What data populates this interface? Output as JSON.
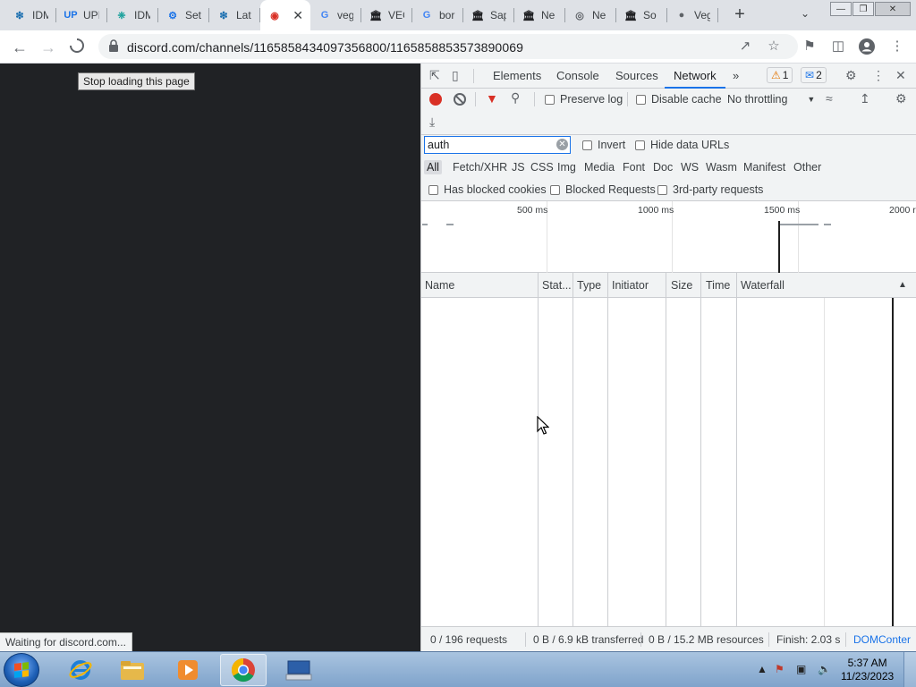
{
  "browser": {
    "tabs": [
      {
        "label": "IDM",
        "icon": "idm-icon",
        "icon_color": "#1b6fb0"
      },
      {
        "label": "UPI",
        "icon": "up-icon",
        "icon_color": "#1a73e8"
      },
      {
        "label": "IDM",
        "icon": "idm-cross-icon",
        "icon_color": "#19a09b"
      },
      {
        "label": "Set",
        "icon": "gear-icon",
        "icon_color": "#1a73e8"
      },
      {
        "label": "Lat",
        "icon": "idm-icon",
        "icon_color": "#1b6fb0"
      },
      {
        "label": "",
        "icon": "discord-icon",
        "icon_color": "#d93025",
        "active": true
      },
      {
        "label": "veg",
        "icon": "google-icon",
        "icon_color": "#4285f4"
      },
      {
        "label": "VEG",
        "icon": "museum-icon",
        "icon_color": "#202124"
      },
      {
        "label": "bor",
        "icon": "google-icon",
        "icon_color": "#4285f4"
      },
      {
        "label": "Sap",
        "icon": "museum-icon",
        "icon_color": "#202124"
      },
      {
        "label": "Ne",
        "icon": "museum-icon",
        "icon_color": "#202124"
      },
      {
        "label": "Ne",
        "icon": "chrome-icon",
        "icon_color": "#5f6368"
      },
      {
        "label": "So",
        "icon": "museum-icon",
        "icon_color": "#202124"
      },
      {
        "label": "Veg",
        "icon": "globe-icon",
        "icon_color": "#5f6368"
      }
    ],
    "url": "discord.com/channels/1165858434097356800/1165858853573890069",
    "tooltip": "Stop loading this page",
    "status_text": "Waiting for discord.com...",
    "page_bg": "#202225"
  },
  "devtools": {
    "tabs": [
      "Elements",
      "Console",
      "Sources",
      "Network"
    ],
    "active_tab": "Network",
    "more_tabs": "»",
    "warnings_count": "1",
    "messages_count": "2",
    "toolbar": {
      "preserve_log": "Preserve log",
      "disable_cache": "Disable cache",
      "throttling": "No throttling"
    },
    "filter": {
      "value": "auth",
      "invert": "Invert",
      "hide_data_urls": "Hide data URLs"
    },
    "type_filters": [
      "All",
      "Fetch/XHR",
      "JS",
      "CSS",
      "Img",
      "Media",
      "Font",
      "Doc",
      "WS",
      "Wasm",
      "Manifest",
      "Other"
    ],
    "active_type": "All",
    "extra_filters": [
      "Has blocked cookies",
      "Blocked Requests",
      "3rd-party requests"
    ],
    "timeline_labels": [
      "500 ms",
      "1000 ms",
      "1500 ms",
      "2000 r"
    ],
    "columns": [
      "Name",
      "Stat...",
      "Type",
      "Initiator",
      "Size",
      "Time",
      "Waterfall"
    ],
    "footer": {
      "requests": "0 / 196 requests",
      "transferred": "0 B / 6.9 kB transferred",
      "resources": "0 B / 15.2 MB resources",
      "finish": "Finish: 2.03 s",
      "domcontent": "DOMConter"
    }
  },
  "taskbar": {
    "time": "5:37 AM",
    "date": "11/23/2023"
  }
}
